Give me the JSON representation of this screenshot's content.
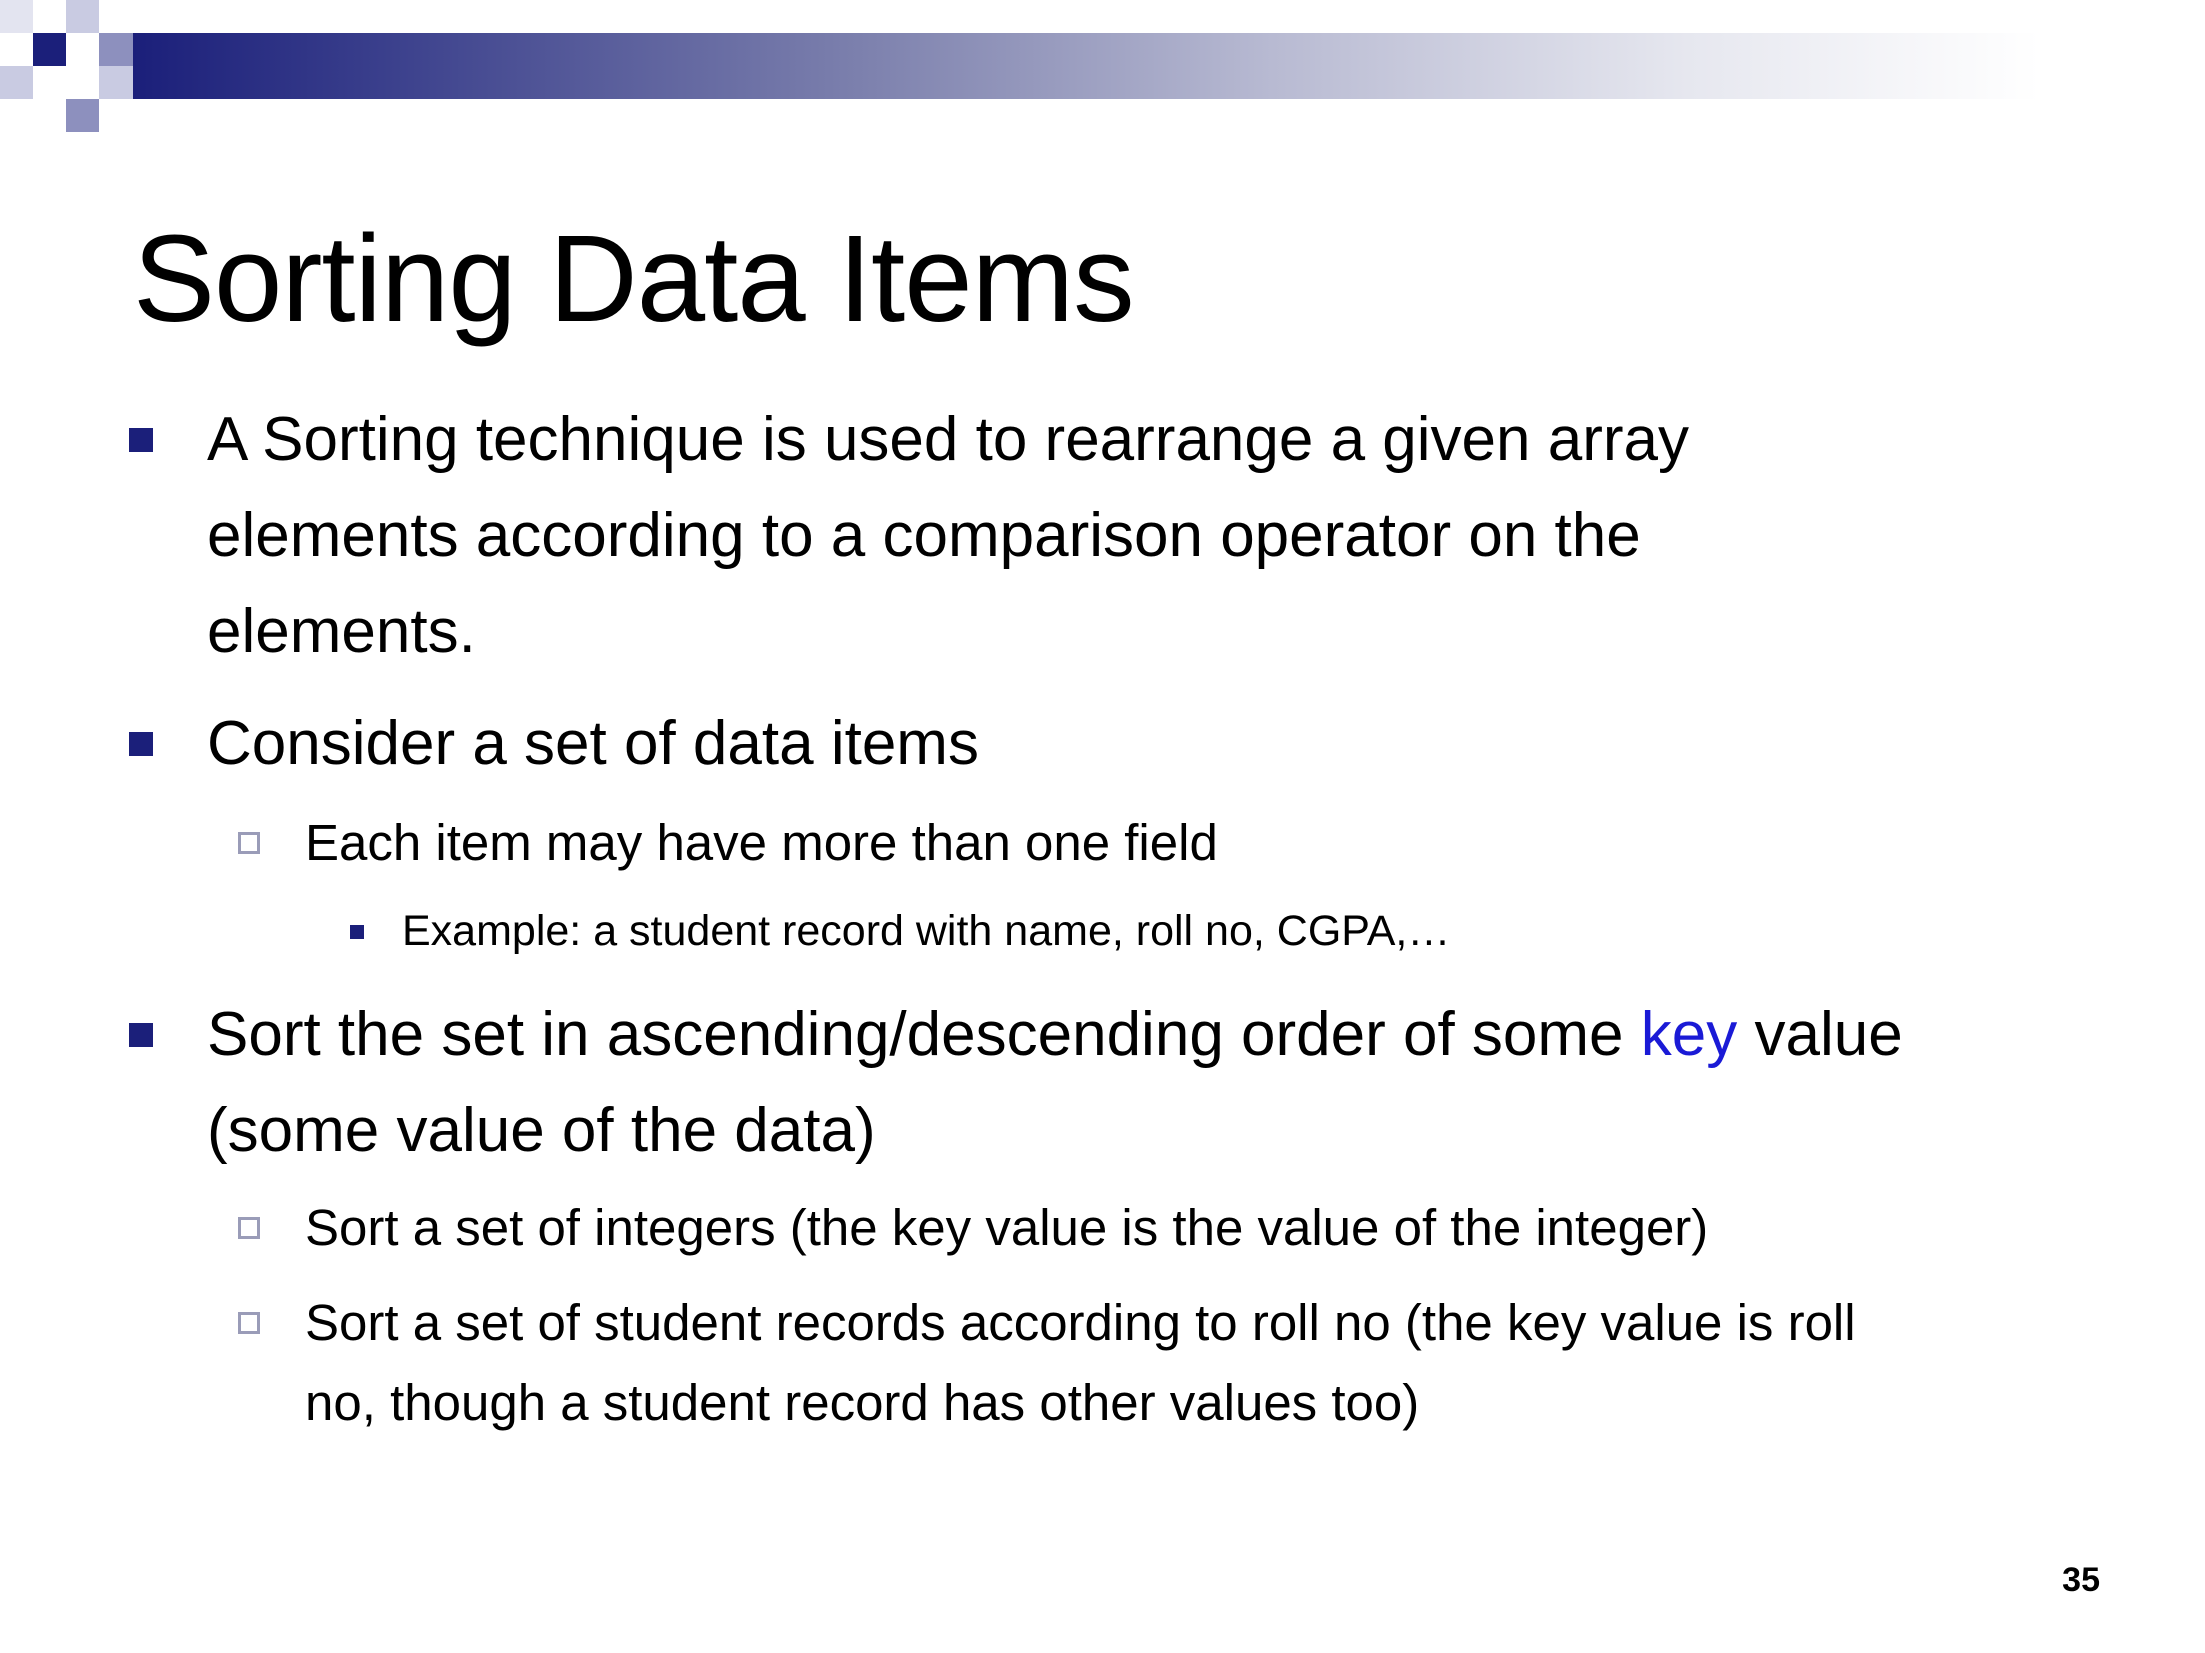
{
  "slide": {
    "title": "Sorting Data Items",
    "bullets": [
      {
        "lines": [
          "A Sorting technique is used to rearrange a given array",
          "elements according to a comparison operator on the",
          "elements."
        ]
      },
      {
        "lines": [
          "Consider a set of data items"
        ],
        "sub": [
          {
            "text": "Each item may have more than one field",
            "sub": [
              {
                "text": "Example: a student record with name, roll no, CGPA,…"
              }
            ]
          }
        ]
      },
      {
        "line1_before": "Sort the set in ascending/descending order of some ",
        "line1_key": "key",
        "line1_after": " value",
        "line2": "(some value of the data)",
        "sub": [
          {
            "text": "Sort a set of integers (the key value is the value of the integer)"
          },
          {
            "lines": [
              "Sort a set of student records according to roll no (the key value is roll",
              "no, though a student record has other values too)"
            ]
          }
        ]
      }
    ],
    "page_number": "35"
  },
  "colors": {
    "accent": "#1b1f7a",
    "key_highlight": "#1a1ad6",
    "hollow_bullet_border": "#9a9cb8"
  }
}
